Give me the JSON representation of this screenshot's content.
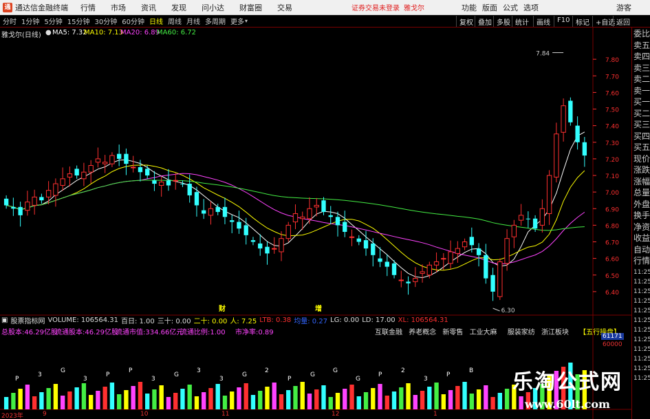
{
  "titlebar": {
    "app_title": "通达信金融终端",
    "menu": [
      "行情",
      "市场",
      "资讯",
      "发现",
      "问小达",
      "财富圈",
      "交易"
    ],
    "alert": "证券交易未登录",
    "stock": "雅戈尔",
    "right": [
      "功能",
      "版面",
      "公式",
      "选项",
      "游客"
    ]
  },
  "toolbar": {
    "periods": [
      "分时",
      "1分钟",
      "5分钟",
      "15分钟",
      "30分钟",
      "60分钟",
      "日线",
      "周线",
      "月线",
      "多周期",
      "更多"
    ],
    "active_period": "日线",
    "right_buttons": [
      "复权",
      "叠加",
      "多股",
      "统计",
      "画线",
      "F10",
      "标记",
      "+自选",
      "返回"
    ]
  },
  "chart": {
    "stock_label": "雅戈尔(日线)",
    "ma": [
      {
        "label": "MA5: 7.32",
        "color": "#ffffff"
      },
      {
        "label": "MA10: 7.13",
        "color": "#ffff00"
      },
      {
        "label": "MA20: 6.89",
        "color": "#ff44ff"
      },
      {
        "label": "MA60: 6.72",
        "color": "#44ee44"
      }
    ],
    "high_label": "7.84",
    "low_label": "6.30",
    "event_labels": [
      {
        "text": "财",
        "x": 318
      },
      {
        "text": "增",
        "x": 458
      }
    ],
    "colors": {
      "up": "#ff3030",
      "down": "#33ffff",
      "axis": "#ff3030"
    }
  },
  "chart_data": {
    "type": "candlestick",
    "title": "雅戈尔(日线)",
    "ylim": [
      6.3,
      7.9
    ],
    "y_ticks": [
      "7.80",
      "7.70",
      "7.60",
      "7.50",
      "7.40",
      "7.30",
      "7.20",
      "7.10",
      "7.00",
      "6.90",
      "6.80",
      "6.70",
      "6.60",
      "6.50",
      "6.40"
    ],
    "closes": [
      6.92,
      6.9,
      6.86,
      6.94,
      6.97,
      6.95,
      7.01,
      7.05,
      7.08,
      7.11,
      7.1,
      7.12,
      7.16,
      7.2,
      7.18,
      7.22,
      7.2,
      7.17,
      7.15,
      7.12,
      7.1,
      7.05,
      7.06,
      7.04,
      7.07,
      7.05,
      6.98,
      6.92,
      6.87,
      6.9,
      6.88,
      6.85,
      6.82,
      6.78,
      6.74,
      6.7,
      6.66,
      6.63,
      6.66,
      6.72,
      6.8,
      6.87,
      6.85,
      6.9,
      6.92,
      6.88,
      6.85,
      6.8,
      6.76,
      6.73,
      6.7,
      6.66,
      6.62,
      6.58,
      6.55,
      6.5,
      6.47,
      6.45,
      6.48,
      6.52,
      6.56,
      6.58,
      6.6,
      6.64,
      6.66,
      6.7,
      6.68,
      6.62,
      6.48,
      6.4,
      6.58,
      6.72,
      6.8,
      6.86,
      6.84,
      6.78,
      6.9,
      7.1,
      7.35,
      7.52,
      7.42,
      7.3,
      7.22
    ],
    "volume_labels": [
      "VOLUME: 106564.31",
      "百日: 1.00",
      "三十: 0.00",
      "二十: 0.00",
      "人: 7.25",
      "LTB: 0.38",
      "均量: 0.27",
      "LG: 0.00",
      "LD: 17.00",
      "XL: 106564.31"
    ]
  },
  "indicator": {
    "name": "股票指标网",
    "colors": [
      "#dddddd",
      "#dddddd",
      "#dddddd",
      "#ffff00",
      "#ffff00",
      "#ff3030",
      "#3366ff",
      "#dddddd",
      "#dddddd",
      "#ff3030"
    ],
    "row2": [
      {
        "text": "总股本:46.29亿股",
        "color": "#ff44ff"
      },
      {
        "text": "流通股本:46.29亿股",
        "color": "#ff44ff"
      },
      {
        "text": "流通市值:334.66亿元",
        "color": "#ff44ff"
      },
      {
        "text": "流通比例:1.00",
        "color": "#ff44ff"
      },
      {
        "text": "市净率:0.89",
        "color": "#ff44ff"
      }
    ],
    "concepts": [
      "互联金融",
      "养老概念",
      "新零售",
      "工业大麻",
      "服装家纺",
      "浙江板块"
    ],
    "wuxing": "【五行操盘】",
    "axis_vals": [
      "61171",
      "60000"
    ]
  },
  "volume_letters": [
    "P",
    "3",
    "G",
    "3",
    "P",
    "P",
    "3",
    "G",
    "3",
    "3",
    "G",
    "2",
    "P",
    "G",
    "G",
    "G",
    "P",
    "2",
    "3",
    "P",
    "B"
  ],
  "date_axis": [
    "2023年",
    "9",
    "10",
    "11",
    "12",
    "1"
  ],
  "quote_panel": [
    "委比",
    "卖五",
    "卖四",
    "卖三",
    "卖二",
    "卖一",
    "买一",
    "买二",
    "买三",
    "买四",
    "买五",
    "现价",
    "涨跌",
    "涨幅",
    "总量",
    "外盘",
    "换手",
    "净资",
    "收益",
    "自动",
    "行情",
    "11:25",
    "11:25",
    "11:25",
    "11:25",
    "11:25",
    "11:25",
    "11:25",
    "11:25",
    "11:25",
    "11:25",
    "11:25",
    "11:25"
  ],
  "watermark": {
    "title": "乐淘公式网",
    "url": "www.60lt.com"
  }
}
